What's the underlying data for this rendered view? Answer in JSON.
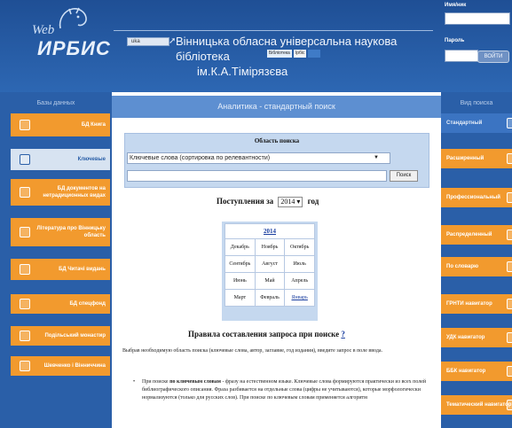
{
  "header": {
    "logo_top": "Web",
    "logo_bottom": "ИРБИС",
    "lang_label": "uka",
    "lib_line1": "Вінницька обласна універсальна наукова бібліотека",
    "lib_line2": "ім.К.А.Тімірязєва",
    "badges": [
      "Бібліотека",
      "Ірбіс",
      ""
    ],
    "login_label": "Имя/ник",
    "password_label": "Пароль",
    "enter_button": "ВОЙТИ"
  },
  "left": {
    "heading": "Базы данных",
    "items": [
      {
        "label": "БД Книга",
        "active": false
      },
      {
        "label": "Ключевые",
        "active": true
      },
      {
        "label": "БД документов на нетрадиционных видах",
        "active": false
      },
      {
        "label": "Література про Вінницьку область",
        "active": false
      },
      {
        "label": "БД Читачі видань",
        "active": false
      },
      {
        "label": "БД спецфонд",
        "active": false
      },
      {
        "label": "Подільський монастир",
        "active": false
      },
      {
        "label": "Шевченко і Вінниччина",
        "active": false
      }
    ]
  },
  "right": {
    "heading": "Вид поиска",
    "items": [
      {
        "label": "Стандартный",
        "active": true
      },
      {
        "label": "Расширенный",
        "active": false
      },
      {
        "label": "Профессиональный",
        "active": false
      },
      {
        "label": "Распределенный",
        "active": false
      },
      {
        "label": "По словарю",
        "active": false
      },
      {
        "label": "ГРНТИ навигатор",
        "active": false
      },
      {
        "label": "УДК навигатор",
        "active": false
      },
      {
        "label": "ББК навигатор",
        "active": false
      },
      {
        "label": "Тематический навигатор",
        "active": false
      }
    ]
  },
  "main": {
    "title": "Аналитика - стандартный поиск",
    "area_title": "Область поиска",
    "area_select": "Ключевые слова (сортировка по релевантности)",
    "search_button": "Поиск",
    "arrivals_label": "Поступления за",
    "arrivals_year": "2014",
    "arrivals_suffix": "год",
    "calendar": {
      "year": "2014",
      "months": [
        [
          "Декабрь",
          "Ноябрь",
          "Октябрь"
        ],
        [
          "Сентябрь",
          "Август",
          "Июль"
        ],
        [
          "Июнь",
          "Май",
          "Апрель"
        ],
        [
          "Март",
          "Февраль",
          "Январь"
        ]
      ],
      "link_month": "Январь"
    },
    "rules_title": "Правила составления запроса при поиске",
    "rules_help": "?",
    "rules_text": "Выбрав необходимую область поиска (ключевые слова, автор, заглавие, год издания), введите запрос в поле ввода.",
    "bullet_lead": "При поиске",
    "bullet_bold": "по ключевым словам",
    "bullet_text": " - фразу на естественном языке. Ключевые слова формируются практически из всех полей библиографического описания. Фраза разбивается на отдельные слова (цифры не учитываются), которые морфологически нормализуются (только для русских слов). При поиске по ключевым словам применяется алгоритм"
  },
  "colors": {
    "bg_blue": "#2a5fa8",
    "nav_orange": "#f29a2e",
    "panel_blue": "#c5d8ef",
    "title_blue": "#5d8fd1"
  }
}
